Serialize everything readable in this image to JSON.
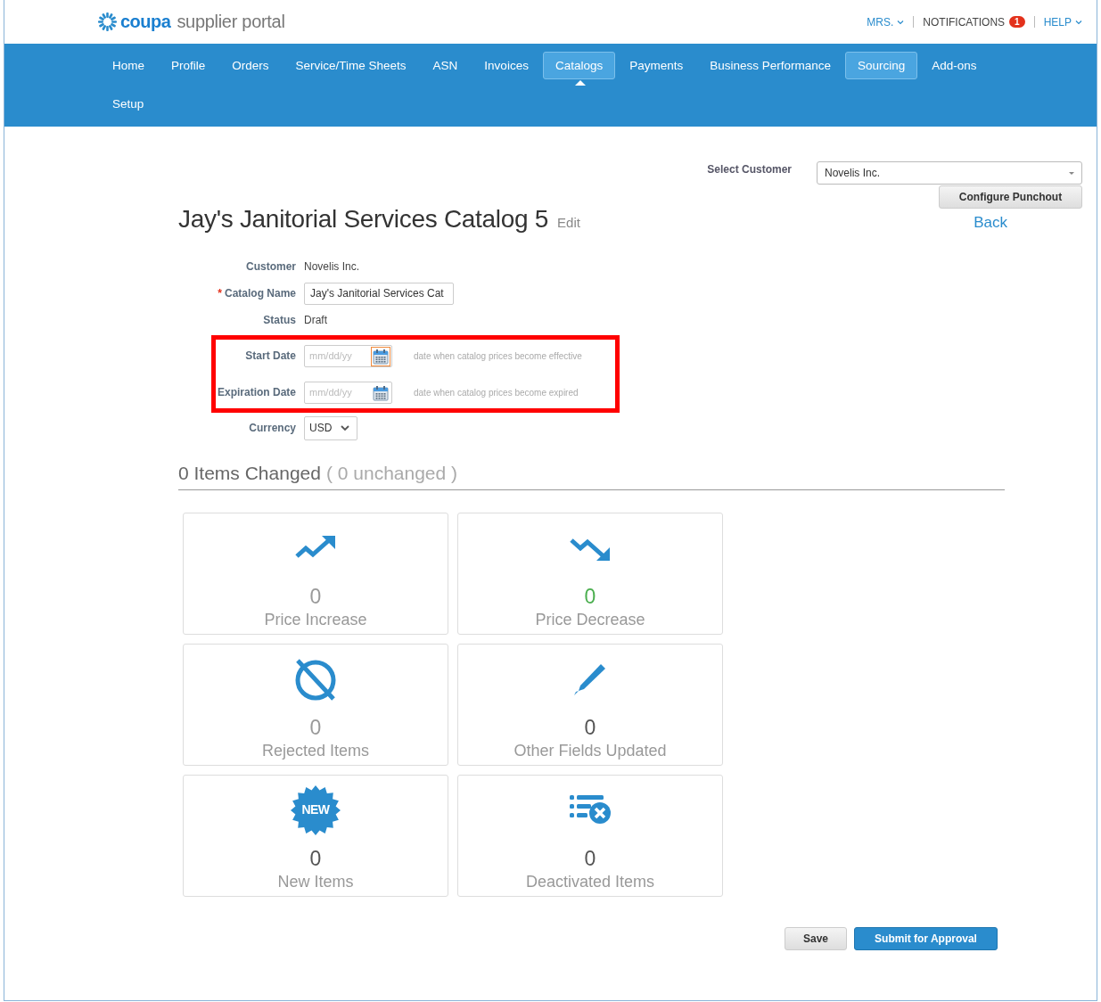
{
  "header": {
    "logo_brand": "coupa",
    "logo_product": "supplier portal",
    "user_menu": "MRS.",
    "notifications": {
      "label": "NOTIFICATIONS",
      "count": "1"
    },
    "help": "HELP"
  },
  "nav": [
    {
      "label": "Home",
      "selected": false,
      "highlighted": false
    },
    {
      "label": "Profile",
      "selected": false,
      "highlighted": false
    },
    {
      "label": "Orders",
      "selected": false,
      "highlighted": false
    },
    {
      "label": "Service/Time Sheets",
      "selected": false,
      "highlighted": false
    },
    {
      "label": "ASN",
      "selected": false,
      "highlighted": false
    },
    {
      "label": "Invoices",
      "selected": false,
      "highlighted": false
    },
    {
      "label": "Catalogs",
      "selected": true,
      "highlighted": true
    },
    {
      "label": "Payments",
      "selected": false,
      "highlighted": false
    },
    {
      "label": "Business Performance",
      "selected": false,
      "highlighted": false
    },
    {
      "label": "Sourcing",
      "selected": false,
      "highlighted": true
    },
    {
      "label": "Add-ons",
      "selected": false,
      "highlighted": false
    },
    {
      "label": "Setup",
      "selected": false,
      "highlighted": false
    }
  ],
  "customer_select": {
    "label": "Select Customer",
    "value": "Novelis Inc.",
    "button": "Configure Punchout"
  },
  "title": "Jay's Janitorial Services Catalog 5",
  "edit_link": "Edit",
  "back_link": "Back",
  "form": [
    {
      "kind": "text",
      "label": "Customer",
      "highlighted": false,
      "value": "Novelis Inc."
    },
    {
      "kind": "input",
      "label": "Catalog Name",
      "required_mark": "*",
      "highlighted": false,
      "value": "Jay's Janitorial Services Cat"
    },
    {
      "kind": "text",
      "label": "Status",
      "highlighted": false,
      "value": "Draft"
    },
    {
      "kind": "date",
      "label": "Start Date",
      "highlighted": true,
      "placeholder": "mm/dd/yy",
      "focused": true,
      "hint": "date when catalog prices become effective"
    },
    {
      "kind": "date",
      "label": "Expiration Date",
      "highlighted": true,
      "placeholder": "mm/dd/yy",
      "focused": false,
      "hint": "date when catalog prices become expired"
    },
    {
      "kind": "select",
      "label": "Currency",
      "highlighted": false,
      "value": "USD"
    }
  ],
  "summary": {
    "heading": "0 Items Changed",
    "subheading": "( 0 unchanged )"
  },
  "tiles": [
    {
      "kind": "increase",
      "count": "0",
      "color": "#9a9a9a",
      "label": "Price Increase"
    },
    {
      "kind": "decrease",
      "count": "0",
      "color": "#4caf50",
      "label": "Price Decrease"
    },
    {
      "kind": "rejected",
      "count": "0",
      "color": "#9a9a9a",
      "label": "Rejected Items"
    },
    {
      "kind": "edited",
      "count": "0",
      "color": "#555555",
      "label": "Other Fields Updated"
    },
    {
      "kind": "new",
      "count": "0",
      "color": "#555555",
      "label": "New Items",
      "badge": "NEW"
    },
    {
      "kind": "deactivated",
      "count": "0",
      "color": "#555555",
      "label": "Deactivated Items"
    }
  ],
  "actions": [
    {
      "kind": "secondary",
      "label": "Save"
    },
    {
      "kind": "primary",
      "label": "Submit for Approval"
    }
  ]
}
